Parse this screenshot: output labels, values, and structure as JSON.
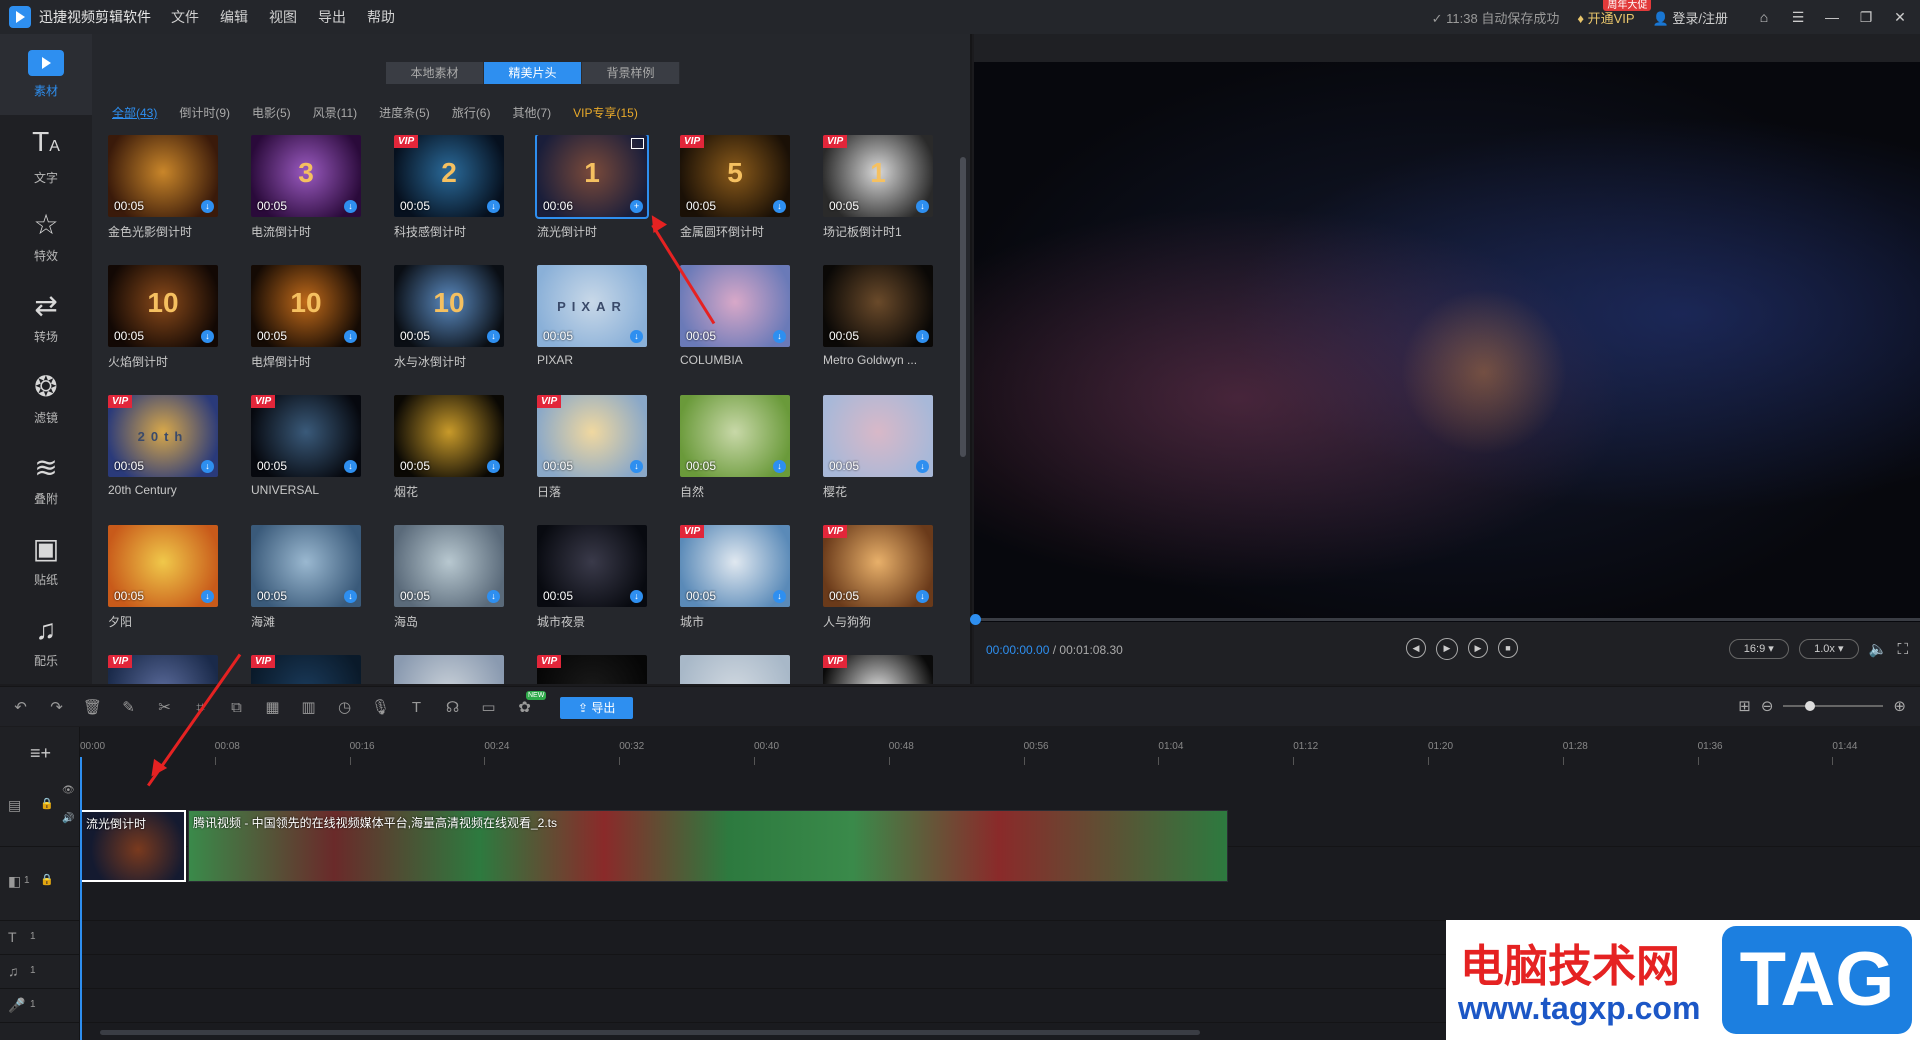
{
  "app": {
    "title": "迅捷视频剪辑软件",
    "menu": [
      "文件",
      "编辑",
      "视图",
      "导出",
      "帮助"
    ],
    "saved_status": "11:38 自动保存成功",
    "vip_label": "开通VIP",
    "vip_badge": "周年大促",
    "login_label": "登录/注册"
  },
  "sidebar": [
    {
      "label": "素材",
      "icon": "media-icon"
    },
    {
      "label": "文字",
      "icon": "text-icon"
    },
    {
      "label": "特效",
      "icon": "effects-icon"
    },
    {
      "label": "转场",
      "icon": "transition-icon"
    },
    {
      "label": "滤镜",
      "icon": "filter-icon"
    },
    {
      "label": "叠附",
      "icon": "overlay-icon"
    },
    {
      "label": "贴纸",
      "icon": "sticker-icon"
    },
    {
      "label": "配乐",
      "icon": "music-icon"
    }
  ],
  "library": {
    "tabs": [
      "本地素材",
      "精美片头",
      "背景样例"
    ],
    "active_tab": "精美片头",
    "categories": [
      "全部(43)",
      "倒计时(9)",
      "电影(5)",
      "风景(11)",
      "进度条(5)",
      "旅行(6)",
      "其他(7)",
      "VIP专享(15)"
    ],
    "items": [
      {
        "name": "金色光影倒计时",
        "duration": "00:05",
        "vip": false,
        "big": "",
        "c1": "#3a1a0a",
        "c2": "#c9862a"
      },
      {
        "name": "电流倒计时",
        "duration": "00:05",
        "vip": false,
        "big": "3",
        "c1": "#2a0a3a",
        "c2": "#9a5ac0"
      },
      {
        "name": "科技感倒计时",
        "duration": "00:05",
        "vip": true,
        "big": "2",
        "c1": "#06101e",
        "c2": "#2a6a9a"
      },
      {
        "name": "流光倒计时",
        "duration": "00:06",
        "vip": false,
        "big": "1",
        "c1": "#1a1e3a",
        "c2": "#7a4a3a"
      },
      {
        "name": "金属圆环倒计时",
        "duration": "00:05",
        "vip": true,
        "big": "5",
        "c1": "#1a1006",
        "c2": "#8a5a1a"
      },
      {
        "name": "场记板倒计时1",
        "duration": "00:05",
        "vip": true,
        "big": "1",
        "c1": "#2a2a2a",
        "c2": "#d8d8d8"
      },
      {
        "name": "火焰倒计时",
        "duration": "00:05",
        "vip": false,
        "big": "10",
        "c1": "#120804",
        "c2": "#8a4a1a"
      },
      {
        "name": "电焊倒计时",
        "duration": "00:05",
        "vip": false,
        "big": "10",
        "c1": "#140a04",
        "c2": "#c06a1a"
      },
      {
        "name": "水与冰倒计时",
        "duration": "00:05",
        "vip": false,
        "big": "10",
        "c1": "#0a0e14",
        "c2": "#5a8ac0"
      },
      {
        "name": "PIXAR",
        "duration": "00:05",
        "vip": false,
        "big": "PIXAR",
        "c1": "#8ab0d8",
        "c2": "#c8d8e8"
      },
      {
        "name": "COLUMBIA",
        "duration": "00:05",
        "vip": false,
        "big": "",
        "c1": "#6a7ab8",
        "c2": "#d8a8c8"
      },
      {
        "name": "Metro Goldwyn ...",
        "duration": "00:05",
        "vip": false,
        "big": "",
        "c1": "#0a0806",
        "c2": "#6a4a2a"
      },
      {
        "name": "20th Century",
        "duration": "00:05",
        "vip": true,
        "big": "20th",
        "c1": "#2a3a7a",
        "c2": "#d8a84a"
      },
      {
        "name": "UNIVERSAL",
        "duration": "00:05",
        "vip": true,
        "big": "",
        "c1": "#06080e",
        "c2": "#3a5a7a"
      },
      {
        "name": "烟花",
        "duration": "00:05",
        "vip": false,
        "big": "",
        "c1": "#0a0804",
        "c2": "#c89a2a"
      },
      {
        "name": "日落",
        "duration": "00:05",
        "vip": true,
        "big": "",
        "c1": "#8aa8c8",
        "c2": "#f0d8a0"
      },
      {
        "name": "自然",
        "duration": "00:05",
        "vip": false,
        "big": "",
        "c1": "#6a9a3a",
        "c2": "#c8d8a8"
      },
      {
        "name": "樱花",
        "duration": "00:05",
        "vip": false,
        "big": "",
        "c1": "#a8b8d8",
        "c2": "#d8b8c8"
      },
      {
        "name": "夕阳",
        "duration": "00:05",
        "vip": false,
        "big": "",
        "c1": "#c85a1a",
        "c2": "#f0c84a"
      },
      {
        "name": "海滩",
        "duration": "00:05",
        "vip": false,
        "big": "",
        "c1": "#3a5a7a",
        "c2": "#9ab8d0"
      },
      {
        "name": "海岛",
        "duration": "00:05",
        "vip": false,
        "big": "",
        "c1": "#5a6a7a",
        "c2": "#b8c8d0"
      },
      {
        "name": "城市夜景",
        "duration": "00:05",
        "vip": false,
        "big": "",
        "c1": "#080a10",
        "c2": "#3a3a4a"
      },
      {
        "name": "城市",
        "duration": "00:05",
        "vip": true,
        "big": "",
        "c1": "#5a8ab8",
        "c2": "#e0e8f0"
      },
      {
        "name": "人与狗狗",
        "duration": "00:05",
        "vip": true,
        "big": "",
        "c1": "#6a3a1a",
        "c2": "#e8b06a"
      },
      {
        "name": "",
        "duration": "",
        "vip": true,
        "big": "",
        "c1": "#1a2a4a",
        "c2": "#5a6a9a"
      },
      {
        "name": "",
        "duration": "",
        "vip": true,
        "big": "",
        "c1": "#0a1a2a",
        "c2": "#1a3a5a"
      },
      {
        "name": "",
        "duration": "",
        "vip": false,
        "big": "",
        "c1": "#8a9ab0",
        "c2": "#c8d0d8"
      },
      {
        "name": "",
        "duration": "",
        "vip": true,
        "big": "",
        "c1": "#060606",
        "c2": "#1a1a1a"
      },
      {
        "name": "",
        "duration": "",
        "vip": false,
        "big": "",
        "c1": "#a8b8c8",
        "c2": "#d0d8e0"
      },
      {
        "name": "",
        "duration": "",
        "vip": true,
        "big": "",
        "c1": "#0a0a0a",
        "c2": "#e0e0e0"
      }
    ],
    "selected_index": 3
  },
  "preview": {
    "current_time": "00:00:00.00",
    "total_time": "00:01:08.30",
    "ratio": "16:9",
    "speed": "1.0x",
    "progress": 0.0
  },
  "toolbar": {
    "export_label": "导出",
    "new_badge": "NEW"
  },
  "timeline": {
    "ruler": [
      "00:00",
      "00:08",
      "00:16",
      "00:24",
      "00:32",
      "00:40",
      "00:48",
      "00:56",
      "01:04",
      "01:12",
      "01:20",
      "01:28",
      "01:36",
      "01:44"
    ],
    "clips": [
      {
        "label": "流光倒计时"
      },
      {
        "label": "腾讯视频 - 中国领先的在线视频媒体平台,海量高清视频在线观看_2.ts"
      }
    ],
    "track_numbers": [
      "1",
      "1",
      "1",
      "1"
    ]
  },
  "watermark": {
    "line1": "电脑技术网",
    "line2": "www.tagxp.com",
    "tag": "TAG"
  },
  "colors": {
    "accent": "#2e8ff0",
    "vip": "#e8a92a",
    "arrow": "#e52222"
  }
}
